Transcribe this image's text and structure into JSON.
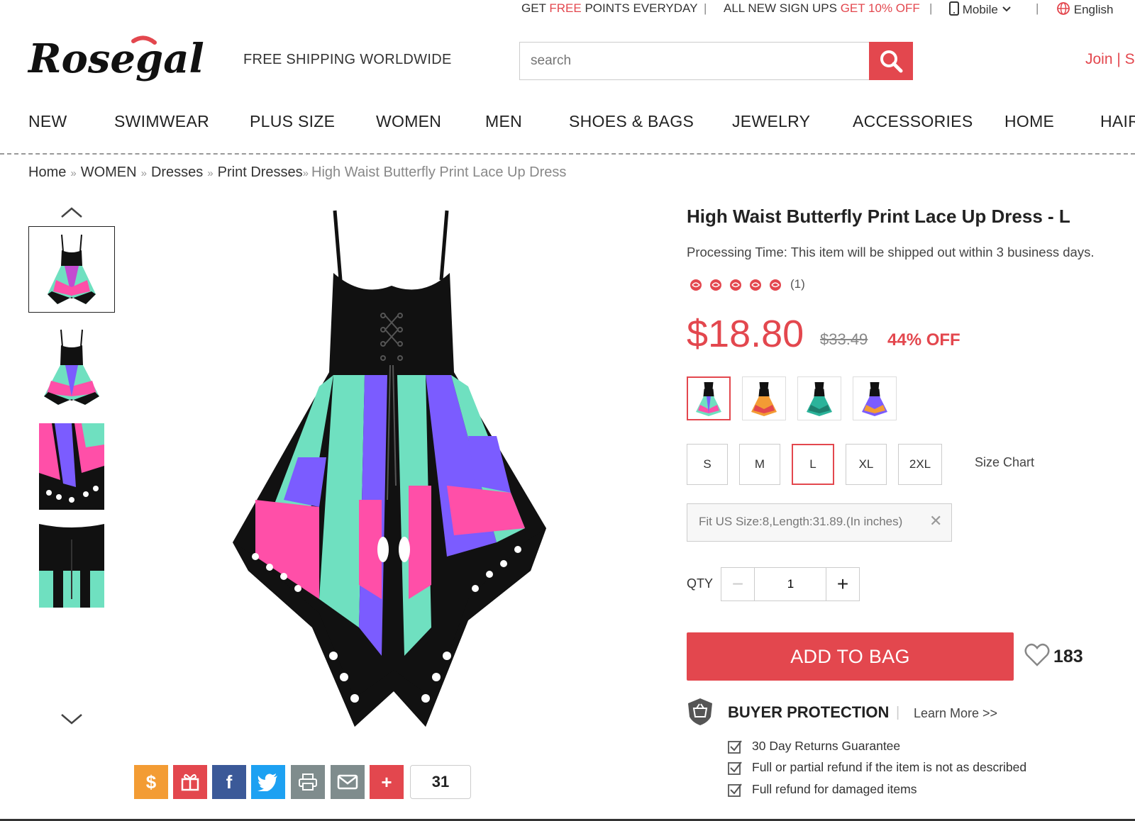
{
  "topbar": {
    "points_prefix": "GET ",
    "points_free": "FREE",
    "points_suffix": " POINTS EVERYDAY",
    "signup_prefix": "ALL NEW SIGN UPS ",
    "signup_offer": "GET 10% OFF",
    "mobile": "Mobile",
    "language": "English",
    "separator": "|"
  },
  "header": {
    "logo_text": "Rosegal",
    "tagline": "FREE SHIPPING WORLDWIDE",
    "search_placeholder": "search",
    "join": "Join  |  S"
  },
  "nav": [
    "NEW",
    "SWIMWEAR",
    "PLUS SIZE",
    "WOMEN",
    "MEN",
    "SHOES & BAGS",
    "JEWELRY",
    "ACCESSORIES",
    "HOME",
    "HAIR"
  ],
  "breadcrumb": {
    "items": [
      "Home",
      "WOMEN",
      "Dresses",
      "Print Dresses"
    ],
    "separator": "»",
    "current": "High Waist Butterfly Print Lace Up Dress"
  },
  "product": {
    "title": "High Waist Butterfly Print Lace Up Dress - L",
    "processing": "Processing Time: This item will be shipped out within 3 business days.",
    "rating": 5,
    "review_count": "(1)",
    "price": "$18.80",
    "old_price": "$33.49",
    "discount": "44% OFF",
    "sizes": [
      "S",
      "M",
      "L",
      "XL",
      "2XL"
    ],
    "selected_size": "L",
    "size_chart": "Size Chart",
    "fit_note": "Fit US Size:8,Length:31.89.(In inches)",
    "qty_label": "QTY",
    "qty_value": "1",
    "add_to_bag": "ADD TO BAG",
    "favorites": "183"
  },
  "buyer_protection": {
    "title": "BUYER PROTECTION",
    "learn_more": "Learn More >>",
    "items": [
      "30 Day Returns Guarantee",
      "Full or partial refund if the item is not as described",
      "Full refund for damaged items"
    ]
  },
  "share": {
    "count": "31",
    "buttons": [
      "earn-money-icon",
      "gift-icon",
      "facebook-icon",
      "twitter-icon",
      "print-icon",
      "email-icon",
      "plus-icon"
    ]
  },
  "colors": {
    "accent": "#e3474e",
    "facebook": "#3b5998",
    "twitter": "#1da1f2",
    "orange": "#f39c34",
    "gray": "#7f8c8d"
  }
}
